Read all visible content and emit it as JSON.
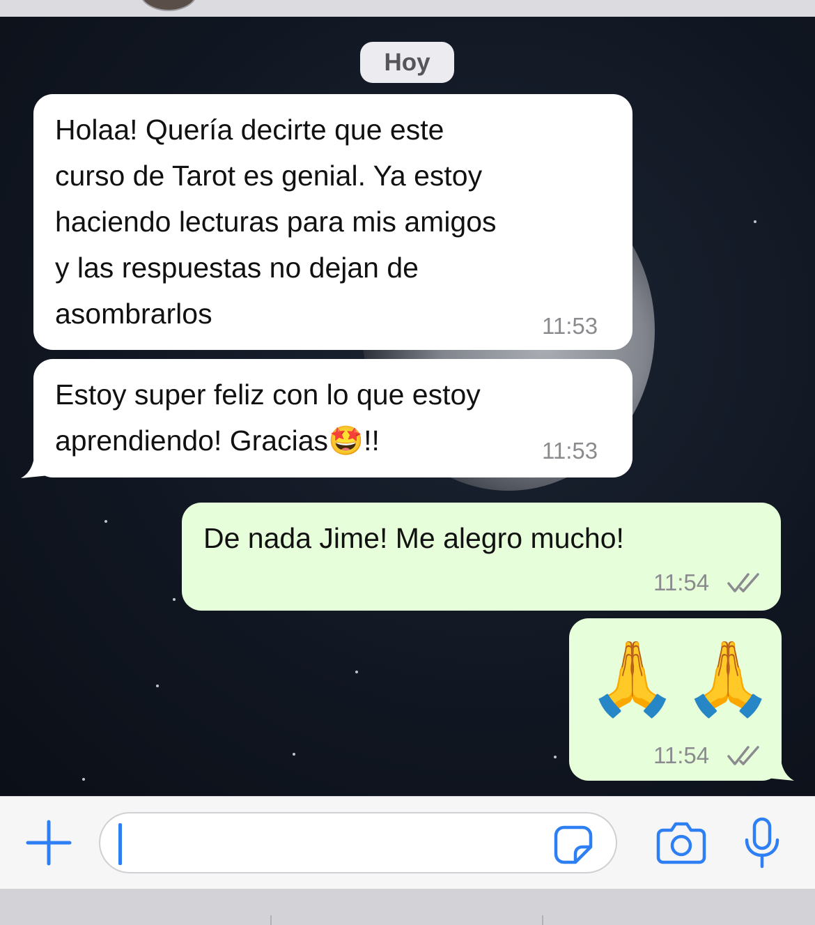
{
  "date_separator": "Hoy",
  "messages": [
    {
      "direction": "incoming",
      "text": "Holaa! Quería decirte que este\ncurso de Tarot es genial. Ya estoy\nhaciendo lecturas para mis amigos\ny las respuestas no dejan de\nasombrarlos",
      "time": "11:53"
    },
    {
      "direction": "incoming",
      "text": "Estoy super feliz con lo que estoy\naprendiendo! Gracias🤩!!",
      "time": "11:53"
    },
    {
      "direction": "outgoing",
      "text": "De nada Jime! Me alegro mucho!",
      "time": "11:54",
      "status": "read-double-check"
    },
    {
      "direction": "outgoing",
      "text": "🙏🙏",
      "time": "11:54",
      "status": "read-double-check"
    }
  ],
  "composer": {
    "input_value": "",
    "icons": [
      "plus-icon",
      "sticker-icon",
      "camera-icon",
      "microphone-icon"
    ]
  },
  "colors": {
    "accent": "#2f7ff4",
    "incoming_bubble": "#ffffff",
    "outgoing_bubble": "#e6fed9",
    "timestamp": "#8b8b8f"
  }
}
